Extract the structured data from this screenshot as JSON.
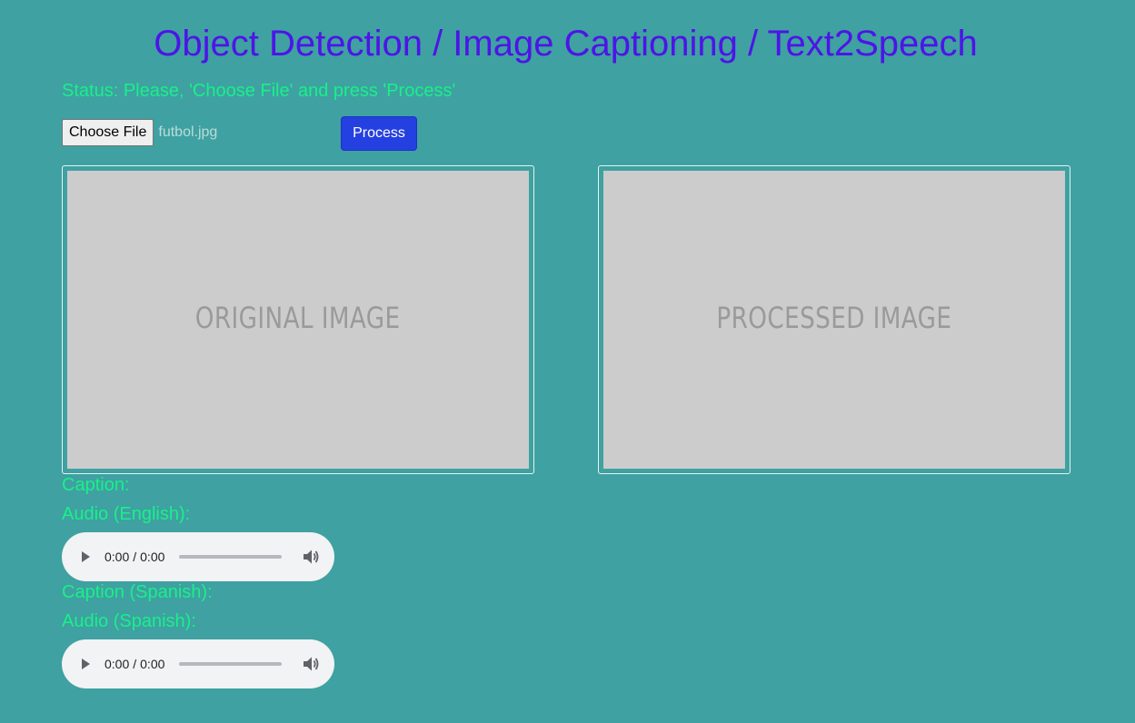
{
  "title": "Object Detection / Image Captioning / Text2Speech",
  "status": "Status: Please, 'Choose File' and press 'Process'",
  "file_input": {
    "button_label": "Choose File",
    "file_name": "futbol.jpg"
  },
  "process_button": "Process",
  "original_image": {
    "placeholder": "ORIGINAL IMAGE"
  },
  "processed_image": {
    "placeholder": "PROCESSED IMAGE"
  },
  "caption_label": "Caption:",
  "audio_english_label": "Audio (English):",
  "caption_spanish_label": "Caption (Spanish):",
  "audio_spanish_label": "Audio (Spanish):",
  "audio_english": {
    "current_time": "0:00",
    "separator": "/",
    "duration": "0:00",
    "progress": 0
  },
  "audio_spanish": {
    "current_time": "0:00",
    "separator": "/",
    "duration": "0:00",
    "progress": 0
  },
  "colors": {
    "background": "#3fa1a1",
    "title": "#4d14e8",
    "status_text": "#19f08a",
    "process_button": "#2540e0",
    "placeholder_bg": "#cccccc"
  },
  "icons": [
    "play-icon",
    "volume-icon"
  ]
}
